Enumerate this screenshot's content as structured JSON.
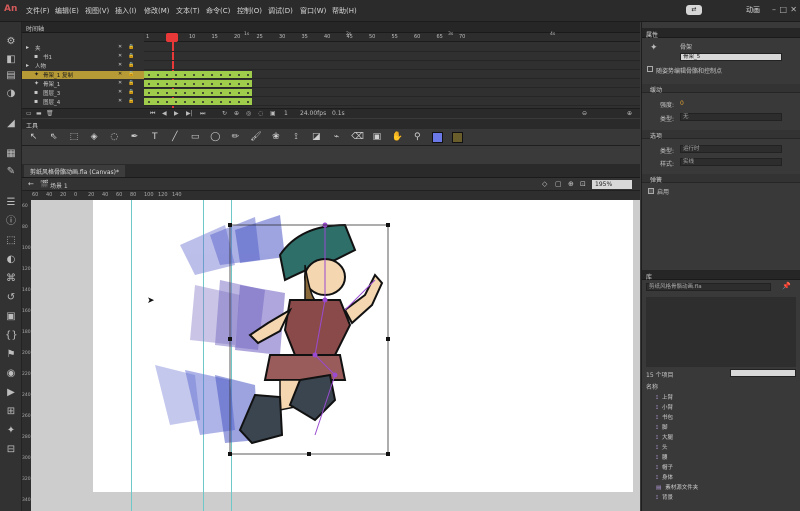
{
  "app": {
    "logo": "An"
  },
  "menu": [
    "文件(F)",
    "编辑(E)",
    "视图(V)",
    "插入(I)",
    "修改(M)",
    "文本(T)",
    "命令(C)",
    "控制(O)",
    "调试(D)",
    "窗口(W)",
    "帮助(H)"
  ],
  "workspace": "动画",
  "timeline": {
    "title": "时间轴",
    "ruler_labels": [
      "1",
      "5",
      "10",
      "15",
      "20",
      "25",
      "30",
      "35",
      "40",
      "45",
      "50",
      "55",
      "60",
      "65",
      "70"
    ],
    "seconds": [
      "1s",
      "2s",
      "3s",
      "4s"
    ],
    "layers": [
      {
        "name": "夹",
        "type": "folder",
        "selected": false,
        "filled": false
      },
      {
        "name": "书1",
        "type": "layer",
        "selected": false,
        "filled": false
      },
      {
        "name": "人物",
        "type": "folder",
        "selected": false,
        "filled": false
      },
      {
        "name": "骨架_1 复制",
        "type": "armature",
        "selected": true,
        "filled": true
      },
      {
        "name": "骨架_1",
        "type": "armature",
        "selected": false,
        "filled": true
      },
      {
        "name": "图层_3",
        "type": "layer",
        "selected": false,
        "filled": true
      },
      {
        "name": "图层_4",
        "type": "layer",
        "selected": false,
        "filled": true
      }
    ],
    "controls": {
      "fps": "24.00fps",
      "time": "0.1s",
      "frame": "1"
    }
  },
  "tools_title": "工具",
  "tools": [
    "selection-icon",
    "subselect-icon",
    "free-transform-icon",
    "3d-rotation-icon",
    "lasso-icon",
    "pen-icon",
    "text-icon",
    "line-icon",
    "rectangle-icon",
    "oval-icon",
    "pencil-icon",
    "brush-icon",
    "deco-icon",
    "bone-icon",
    "paint-bucket-icon",
    "eyedropper-icon",
    "eraser-icon",
    "camera-icon",
    "hand-icon",
    "zoom-icon",
    "stroke-color-icon",
    "fill-color-icon"
  ],
  "document": {
    "tab": "剪纸风格骨骼动画.fla (Canvas)*",
    "scene": "场景 1",
    "zoom": "195%",
    "hruler": [
      "60",
      "40",
      "20",
      "0",
      "20",
      "40",
      "60",
      "80",
      "100",
      "120",
      "140"
    ],
    "vruler": [
      "60",
      "80",
      "100",
      "120",
      "140",
      "160",
      "180",
      "200",
      "220",
      "240",
      "260",
      "280",
      "300",
      "320",
      "340"
    ]
  },
  "properties": {
    "title": "属性",
    "object_type": "骨架",
    "name_value": "骨架_5",
    "checkbox_label": "随姿势编辑骨骼和控制点",
    "section_ease": "缓动",
    "strength_label": "强度:",
    "strength_value": "0",
    "type_label": "类型:",
    "type_value": "无",
    "section_options": "选项",
    "style_label": "类型:",
    "style_value": "运行时",
    "style2_label": "样式:",
    "style2_value": "实线",
    "section_spring": "弹簧",
    "spring_label": "启用"
  },
  "library": {
    "title": "库",
    "file": "剪纸风格骨骼动画.fla",
    "count": "15 个项目",
    "search_placeholder": "",
    "column_name": "名称",
    "items": [
      "上臂",
      "小臂",
      "书包",
      "脚",
      "大腿",
      "头",
      "腰",
      "帽子",
      "身体",
      "素材源文件夹",
      "背景"
    ]
  },
  "colors": {
    "selected_layer": "#b59a36",
    "frames": "#9fcc4a",
    "playhead": "#e83838",
    "guide": "#6fc7c7"
  }
}
